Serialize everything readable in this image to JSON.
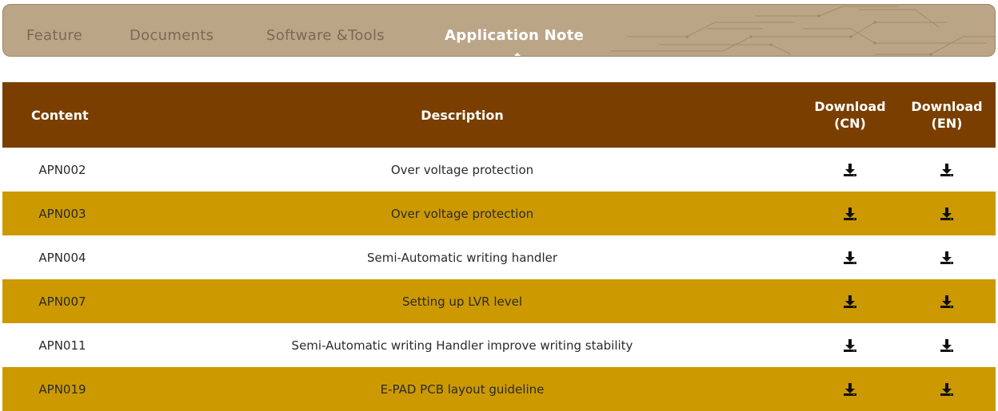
{
  "tabs": [
    {
      "label": "Feature",
      "active": false
    },
    {
      "label": "Documents",
      "active": false
    },
    {
      "label": "Software &Tools",
      "active": false
    },
    {
      "label": "Application Note",
      "active": true
    }
  ],
  "table": {
    "headers": {
      "content": "Content",
      "description": "Description",
      "download_cn": [
        "Download",
        "(CN)"
      ],
      "download_en": [
        "Download",
        "(EN)"
      ]
    },
    "rows": [
      {
        "content": "APN002",
        "description": "Over voltage protection"
      },
      {
        "content": "APN003",
        "description": "Over voltage protection"
      },
      {
        "content": "APN004",
        "description": "Semi-Automatic writing handler"
      },
      {
        "content": "APN007",
        "description": "Setting up LVR level"
      },
      {
        "content": "APN011",
        "description": "Semi-Automatic writing Handler improve writing stability"
      },
      {
        "content": "APN019",
        "description": "E-PAD PCB layout guideline"
      }
    ]
  },
  "icons": {
    "download": "download-icon"
  },
  "colors": {
    "tabbar_bg": "#bba587",
    "header_bg": "#7a3f00",
    "alt_row_bg": "#cc9900",
    "tab_inactive": "#7a6a55",
    "tab_active": "#ffffff"
  }
}
